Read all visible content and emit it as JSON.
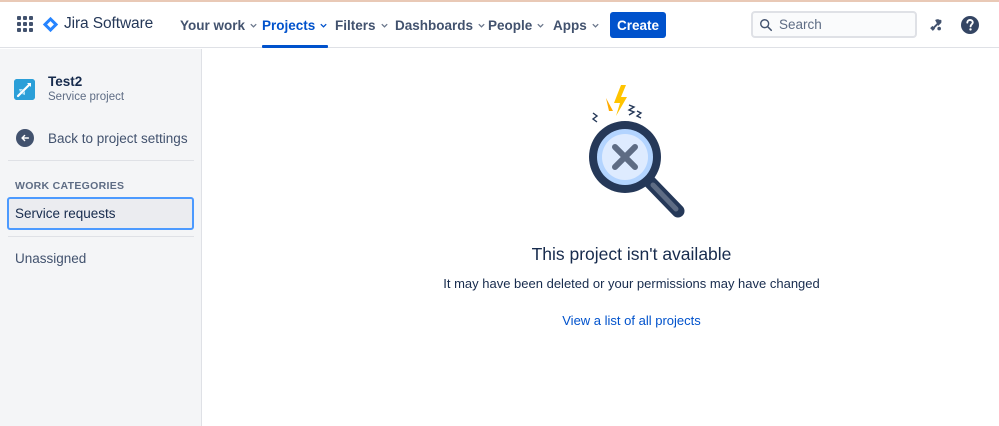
{
  "header": {
    "logo_text": "Jira Software",
    "nav": [
      {
        "label": "Your work"
      },
      {
        "label": "Projects"
      },
      {
        "label": "Filters"
      },
      {
        "label": "Dashboards"
      },
      {
        "label": "People"
      },
      {
        "label": "Apps"
      }
    ],
    "active_nav": "Projects",
    "create_label": "Create",
    "search_placeholder": "Search",
    "accent_color": "#0052cc"
  },
  "sidebar": {
    "project_name": "Test2",
    "project_type": "Service project",
    "back_label": "Back to project settings",
    "section_title": "WORK CATEGORIES",
    "items": [
      {
        "label": "Service requests",
        "selected": true
      },
      {
        "label": "Unassigned",
        "selected": false
      }
    ]
  },
  "main": {
    "title": "This project isn't available",
    "subtitle": "It may have been deleted or your permissions may have changed",
    "link_label": "View a list of all projects"
  }
}
